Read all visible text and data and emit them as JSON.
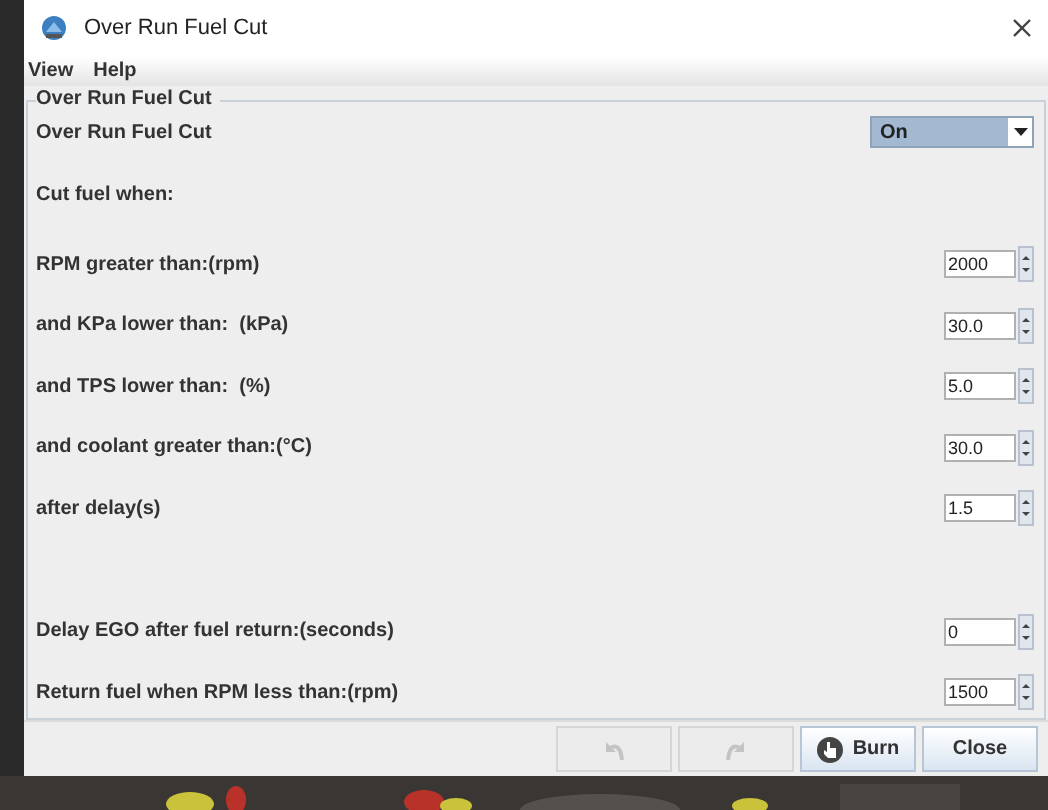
{
  "window": {
    "title": "Over Run Fuel Cut"
  },
  "menu": [
    {
      "label": "View"
    },
    {
      "label": "Help"
    }
  ],
  "group": {
    "title": "Over Run Fuel Cut"
  },
  "fields": [
    {
      "kind": "select",
      "label": "Over Run Fuel Cut",
      "value": "On"
    },
    {
      "kind": "heading",
      "label": "Cut fuel when:"
    },
    {
      "kind": "spinner",
      "label": "RPM greater than:(rpm)",
      "value": "2000"
    },
    {
      "kind": "spinner",
      "label": "and KPa lower than:  (kPa)",
      "value": "30.0"
    },
    {
      "kind": "spinner",
      "label": "and TPS lower than:  (%)",
      "value": "5.0"
    },
    {
      "kind": "spinner",
      "label": "and coolant greater than:(°C)",
      "value": "30.0"
    },
    {
      "kind": "spinner",
      "label": "after delay(s)",
      "value": "1.5"
    },
    {
      "kind": "gap"
    },
    {
      "kind": "spinner",
      "label": "Delay EGO after fuel return:(seconds)",
      "value": "0"
    },
    {
      "kind": "spinner",
      "label": "Return fuel when RPM less than:(rpm)",
      "value": "1500"
    }
  ],
  "buttons": [
    {
      "kind": "undo",
      "disabled": true
    },
    {
      "kind": "redo",
      "disabled": true
    },
    {
      "kind": "burn",
      "label": "Burn",
      "disabled": false
    },
    {
      "kind": "close",
      "label": "Close",
      "disabled": false
    }
  ]
}
